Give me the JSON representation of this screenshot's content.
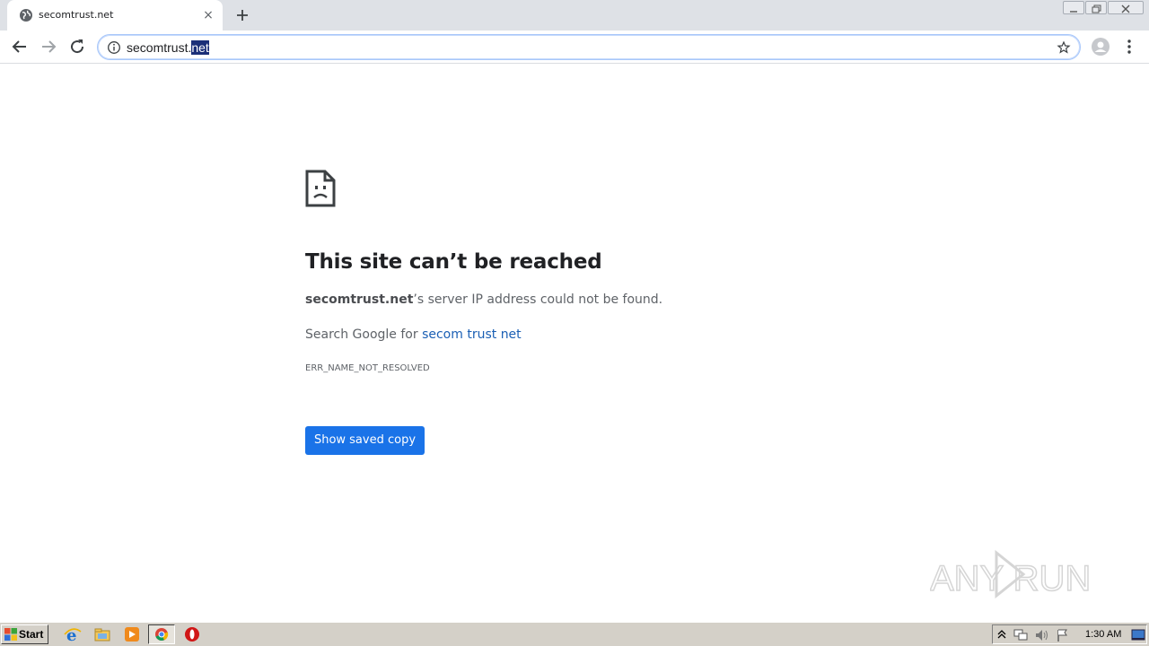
{
  "tab": {
    "title": "secomtrust.net",
    "favicon": "globe-icon",
    "close": "×"
  },
  "toolbar": {
    "back": "back-arrow-icon",
    "forward": "forward-arrow-icon",
    "reload": "reload-icon",
    "url_plain": "secomtrust.",
    "url_selected": "net",
    "bookmark": "star-icon",
    "profile": "profile-icon",
    "menu": "kebab-menu-icon"
  },
  "page": {
    "heading": "This site can’t be reached",
    "server_domain": "secomtrust.net",
    "server_msg_rest": "’s server IP address could not be found.",
    "search_prefix": "Search Google for ",
    "search_link": "secom trust net",
    "error_code": "ERR_NAME_NOT_RESOLVED",
    "saved_copy_button": "Show saved copy"
  },
  "watermark": {
    "text": "ANY RUN"
  },
  "taskbar": {
    "start_label": "Start",
    "apps": [
      "ie-icon",
      "explorer-folder-icon",
      "media-player-icon",
      "chrome-icon",
      "opera-icon"
    ],
    "clock": "1:30 AM"
  },
  "colors": {
    "accent": "#1a73e8",
    "link": "#1a5fb4",
    "tabstrip": "#dee1e6",
    "taskbar": "#d4d0c8"
  }
}
